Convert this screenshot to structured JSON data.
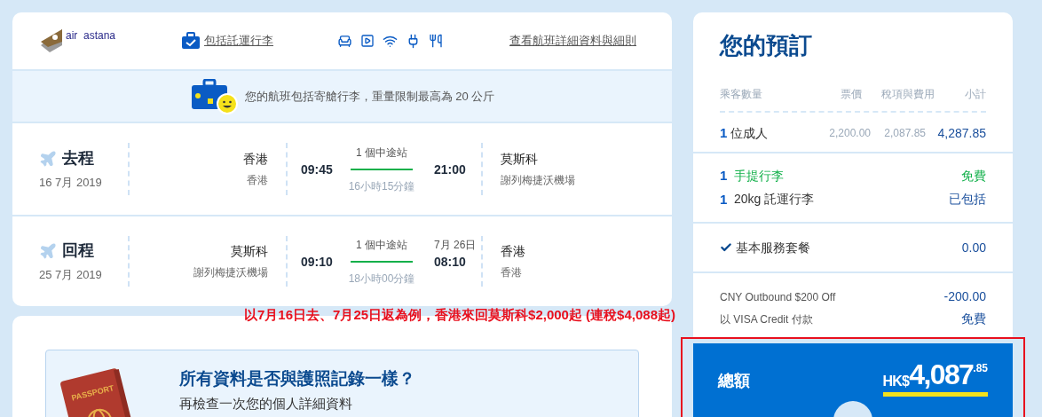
{
  "airline": {
    "name": "air  astana"
  },
  "header_links": {
    "baggage": "包括託運行李",
    "details": "查看航班詳細資料與細則"
  },
  "baggage_notice": "您的航班包括寄艙行李，重量限制最高為 20 公斤",
  "flights": [
    {
      "label": "去程",
      "date": "16 7月 2019",
      "from_city": "香港",
      "from_airport": "香港",
      "depart": "09:45",
      "stops": "1 個中途站",
      "arrive": "21:00",
      "duration": "16小時15分鐘",
      "to_city": "莫斯科",
      "to_airport": "謝列梅捷沃機場"
    },
    {
      "label": "回程",
      "date": "25 7月 2019",
      "from_city": "莫斯科",
      "from_airport": "謝列梅捷沃機場",
      "depart": "09:10",
      "stops": "1 個中途站",
      "arrive": "08:10",
      "arrive_date": "7月 26日",
      "duration": "18小時00分鐘",
      "to_city": "香港",
      "to_airport": "香港"
    }
  ],
  "promo_caption": "以7月16日去、7月25日返為例，香港來回莫斯科$2,000起 (連稅$4,088起)",
  "passport_check": {
    "title": "所有資料是否與護照記錄一樣？",
    "subtitle": "再檢查一次您的個人詳細資料",
    "passport_label": "PASSPORT"
  },
  "booking": {
    "title": "您的預訂",
    "columns": [
      "乘客數量",
      "票價",
      "稅項與費用",
      "小計"
    ],
    "passengers": [
      {
        "count": "1",
        "label": "位成人",
        "fare": "2,200.00",
        "taxes": "2,087.85",
        "subtotal": "4,287.85"
      }
    ],
    "baggage": [
      {
        "count": "1",
        "label": "手提行李",
        "price": "免費",
        "kind": "free"
      },
      {
        "count": "1",
        "label": "20kg 託運行李",
        "price": "已包括",
        "kind": "included"
      }
    ],
    "service": {
      "label": "基本服務套餐",
      "price": "0.00",
      "checked": true
    },
    "adjustments": [
      {
        "label": "CNY Outbound $200 Off",
        "value": "-200.00"
      },
      {
        "label": "以 VISA Credit 付款",
        "value": "免費"
      }
    ],
    "total": {
      "label": "總額",
      "currency": "HK$",
      "amount": "4,087",
      "cents": ".85",
      "highlighted": true
    }
  }
}
